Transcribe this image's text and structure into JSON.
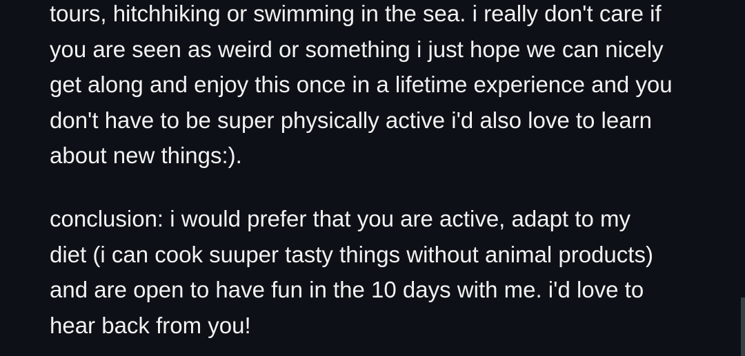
{
  "message": {
    "paragraphs": [
      {
        "lines": [
          "tours, hitchhiking or swimming in the sea. i really don't care if",
          "you are seen as weird or something i just hope we can nicely",
          "get along and enjoy this once in a lifetime experience and you",
          "don't have to be super physically active i'd also love to learn",
          "about new things:)."
        ]
      },
      {
        "lines": [
          "conclusion: i would prefer that you are active, adapt to my",
          "diet (i can cook suuper tasty things without animal products)",
          "and are open to have fun in the 10 days with me. i'd love to",
          "hear back from you!"
        ]
      }
    ]
  },
  "colors": {
    "background": "#0d1117",
    "text": "#f2f2f2",
    "scrollbar_thumb": "#3a3f46"
  }
}
